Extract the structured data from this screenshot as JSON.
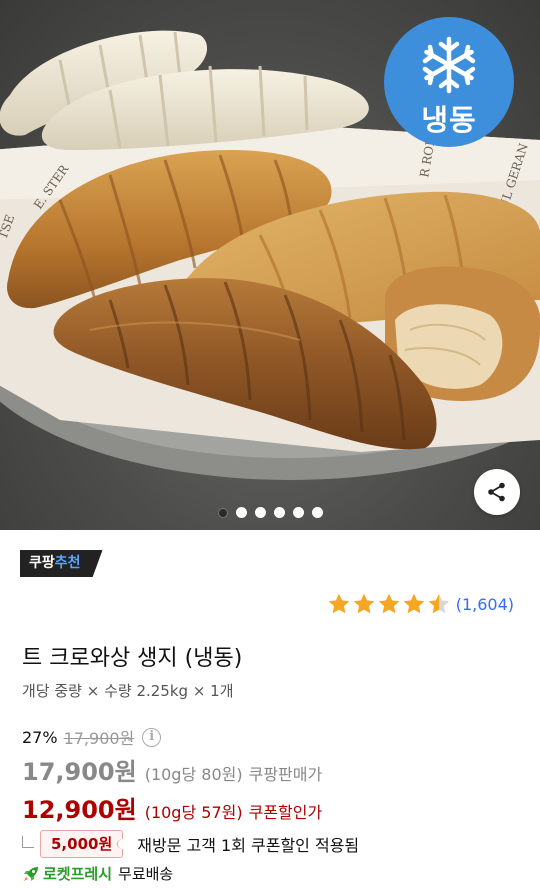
{
  "hero": {
    "badge_label": "냉동",
    "badge_icon": "snowflake-icon",
    "share_icon": "share-icon",
    "carousel": {
      "total": 6,
      "active": 1
    },
    "paper_text": [
      "E. STER",
      "R ROBE",
      "PAUL GERAN",
      "TSE"
    ]
  },
  "product": {
    "recommend_badge": {
      "prefix": "쿠팡",
      "accent": "추천"
    },
    "rating": {
      "value": 4.5,
      "max": 5,
      "count_text": "(1,604)"
    },
    "title": "트 크로와상 생지 (냉동)",
    "spec": "개당 중량 × 수량 2.25kg × 1개",
    "discount": {
      "percent": "27%",
      "original_price": "17,900원"
    },
    "sale_price": {
      "amount": "17,900원",
      "unit_price": "(10g당 80원)",
      "label": "쿠팡판매가"
    },
    "coupon_price": {
      "amount": "12,900원",
      "unit_price": "(10g당 57원)",
      "label": "쿠폰할인가"
    },
    "coupon": {
      "tag": "5,000원",
      "note": "재방문 고객 1회 쿠폰할인 적용됨"
    },
    "shipping": {
      "badge": "로켓프레시",
      "text": "무료배송"
    }
  },
  "colors": {
    "link_blue": "#346aff",
    "coupon_red": "#ae0000",
    "star_gold": "#f5a623",
    "badge_blue": "#3d8fdb",
    "rocket_green": "#2a9d2a"
  }
}
